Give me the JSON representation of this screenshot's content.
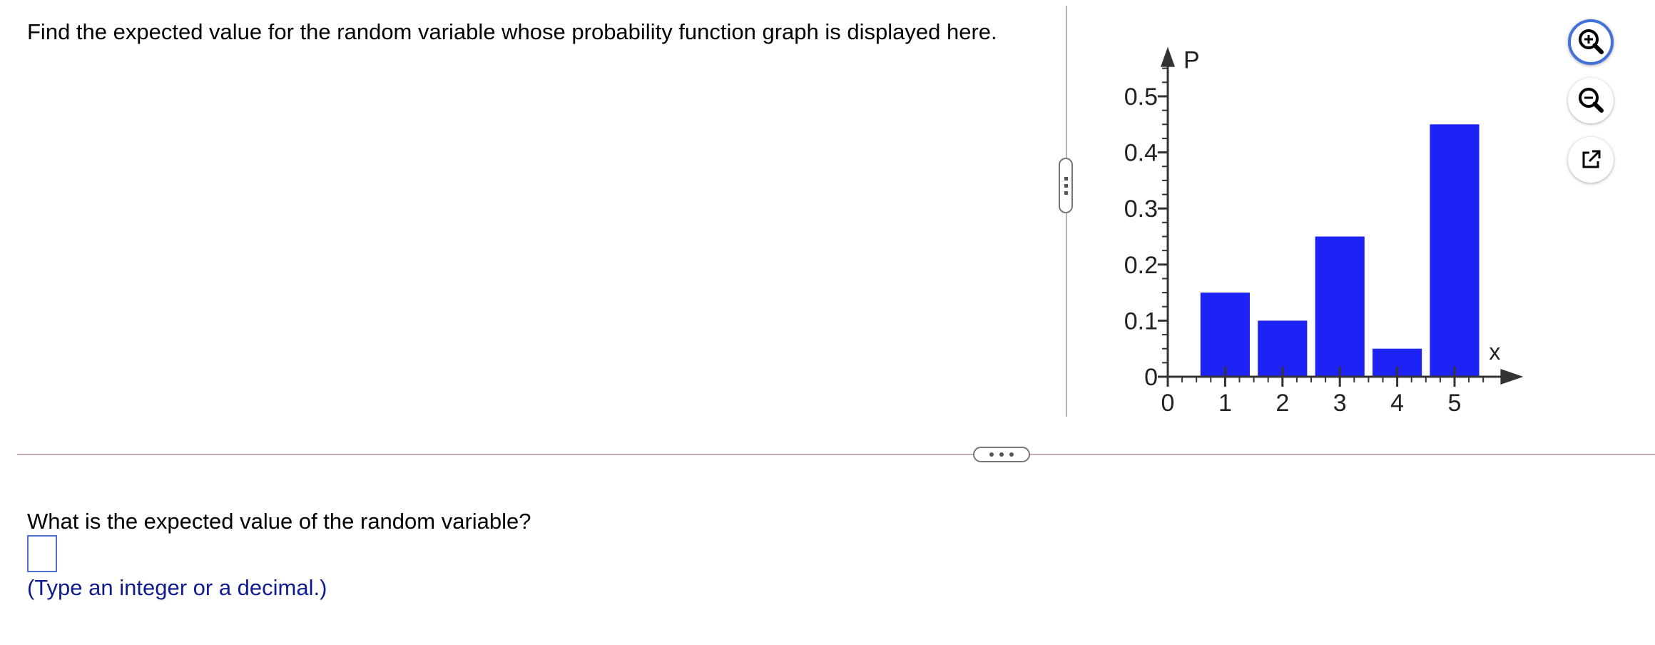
{
  "question": {
    "text": "Find the expected value for the random variable whose probability function graph is displayed here."
  },
  "chart_data": {
    "type": "bar",
    "x": [
      1,
      2,
      3,
      4,
      5
    ],
    "values": [
      0.15,
      0.1,
      0.25,
      0.05,
      0.45
    ],
    "xlabel": "x",
    "ylabel": "P",
    "x_ticks": [
      "0",
      "1",
      "2",
      "3",
      "4",
      "5"
    ],
    "y_ticks": [
      "0",
      "0.1",
      "0.2",
      "0.3",
      "0.4",
      "0.5"
    ],
    "xlim": [
      0,
      6
    ],
    "ylim": [
      0,
      0.55
    ],
    "grid": false,
    "bar_color": "#1d22f5"
  },
  "toolbar": {
    "zoom_in_icon": "zoom-in-icon",
    "zoom_out_icon": "zoom-out-icon",
    "popout_icon": "external-link-icon",
    "accent_color": "#4272d7"
  },
  "answer": {
    "prompt": "What is the expected value of the random variable?",
    "value": "",
    "hint": "(Type an integer or a decimal.)"
  }
}
